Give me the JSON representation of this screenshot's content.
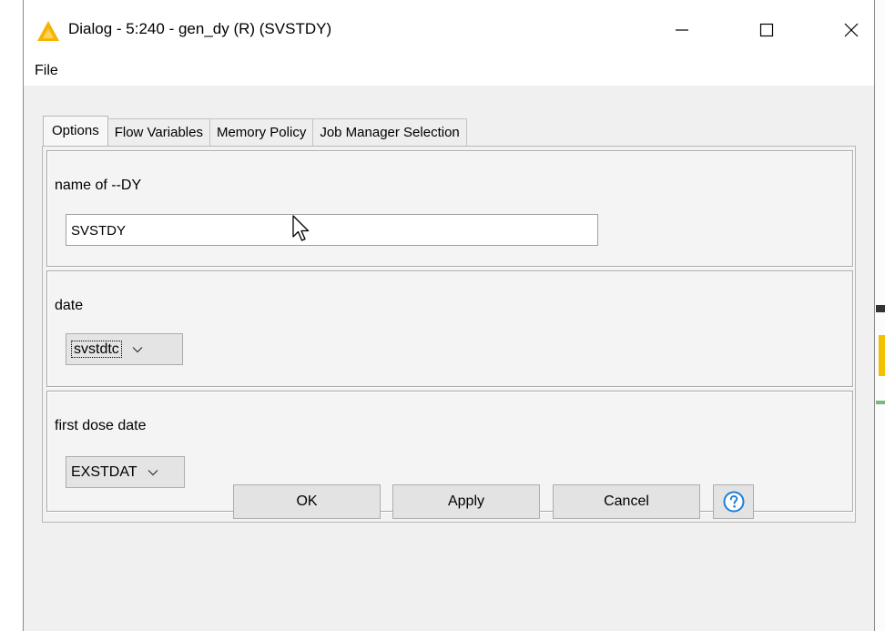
{
  "window": {
    "title": "Dialog - 5:240 - gen_dy (R) (SVSTDY)",
    "icon": "knime-warning-triangle-icon",
    "accent_color": "#f5b400",
    "controls": [
      "minimize-icon",
      "maximize-icon",
      "close-icon"
    ]
  },
  "menu": {
    "file_label": "File"
  },
  "tabs": [
    {
      "label": "Options",
      "active": true
    },
    {
      "label": "Flow Variables",
      "active": false
    },
    {
      "label": "Memory Policy",
      "active": false
    },
    {
      "label": "Job Manager Selection",
      "active": false
    }
  ],
  "sections": {
    "name": {
      "label": "name of --DY",
      "value": "SVSTDY"
    },
    "date": {
      "label": "date",
      "selected": "svstdtc"
    },
    "first_dose": {
      "label": "first dose date",
      "selected": "EXSTDAT"
    }
  },
  "buttons": {
    "ok": "OK",
    "apply": "Apply",
    "cancel": "Cancel",
    "help_icon": "question-circle-icon",
    "help_color": "#1e7fd8"
  }
}
